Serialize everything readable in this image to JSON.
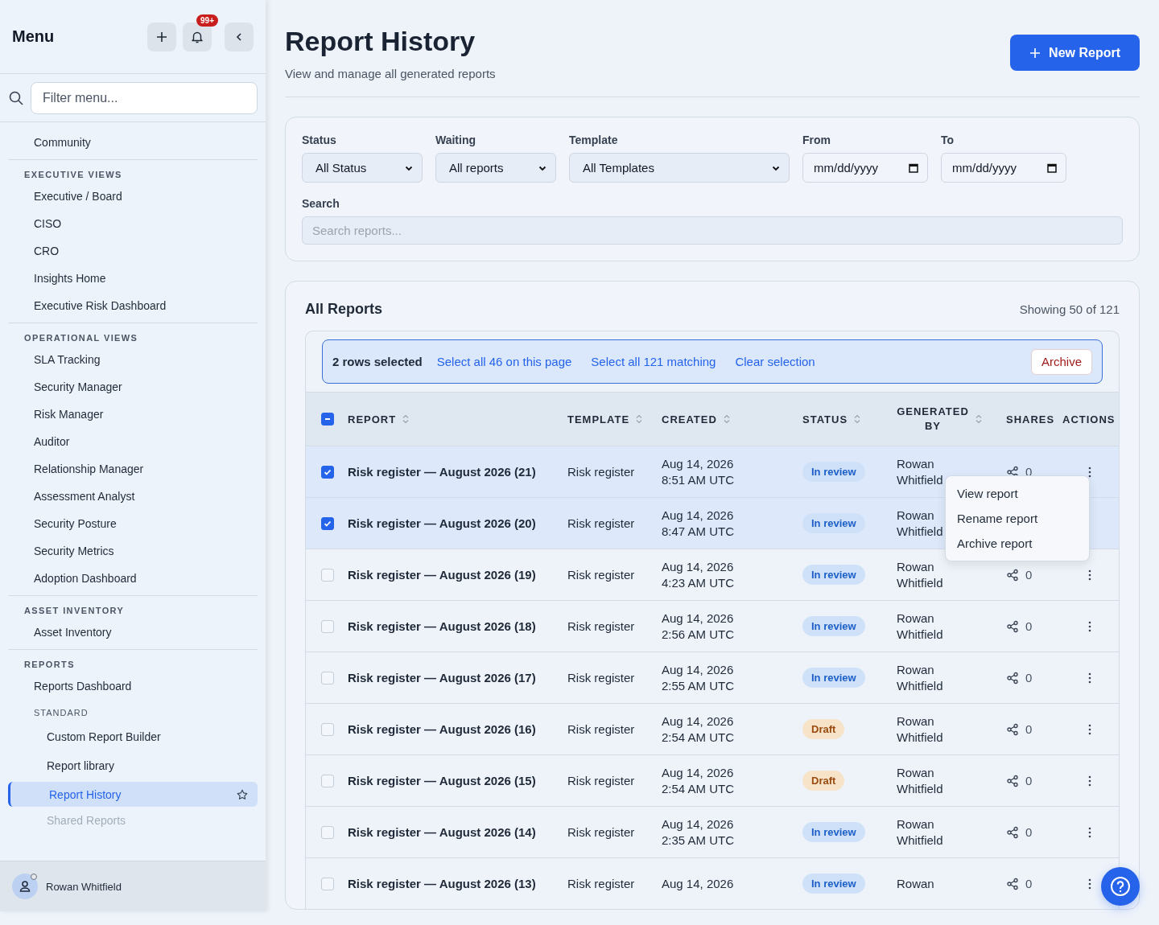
{
  "sidebar": {
    "title": "Menu",
    "notification_count": "99+",
    "filter_placeholder": "Filter menu...",
    "sections": [
      {
        "items": [
          {
            "kind": "link",
            "label": "Community",
            "selected": false
          }
        ]
      },
      {
        "label": "EXECUTIVE VIEWS",
        "items": [
          {
            "kind": "link",
            "label": "Executive / Board",
            "selected": false
          },
          {
            "kind": "link",
            "label": "CISO",
            "selected": false
          },
          {
            "kind": "link",
            "label": "CRO",
            "selected": false
          },
          {
            "kind": "link",
            "label": "Insights Home",
            "selected": false
          },
          {
            "kind": "link",
            "label": "Executive Risk Dashboard",
            "selected": false
          }
        ]
      },
      {
        "label": "OPERATIONAL VIEWS",
        "items": [
          {
            "kind": "link",
            "label": "SLA Tracking",
            "selected": false
          },
          {
            "kind": "link",
            "label": "Security Manager",
            "selected": false
          },
          {
            "kind": "link",
            "label": "Risk Manager",
            "selected": false
          },
          {
            "kind": "link",
            "label": "Auditor",
            "selected": false
          },
          {
            "kind": "link",
            "label": "Relationship Manager",
            "selected": false
          },
          {
            "kind": "link",
            "label": "Assessment Analyst",
            "selected": false
          },
          {
            "kind": "link",
            "label": "Security Posture",
            "selected": false
          },
          {
            "kind": "link",
            "label": "Security Metrics",
            "selected": false
          },
          {
            "kind": "link",
            "label": "Adoption Dashboard",
            "selected": false
          }
        ]
      },
      {
        "label": "ASSET INVENTORY",
        "items": [
          {
            "kind": "link",
            "label": "Asset Inventory",
            "selected": false
          }
        ]
      },
      {
        "label": "REPORTS",
        "items": [
          {
            "kind": "link",
            "label": "Reports Dashboard",
            "selected": false
          },
          {
            "kind": "group",
            "label": "STANDARD",
            "children": [
              {
                "kind": "link",
                "label": "Custom Report Builder",
                "selected": false
              },
              {
                "kind": "link",
                "label": "Report library",
                "selected": false
              },
              {
                "kind": "link",
                "label": "Report History",
                "selected": true
              },
              {
                "kind": "link",
                "label": "Shared Reports",
                "selected": false
              }
            ]
          }
        ]
      }
    ],
    "user": {
      "name": "Rowan Whitfield"
    }
  },
  "header": {
    "title": "Report History",
    "subtitle": "View and manage all generated reports",
    "new_button": "New Report"
  },
  "filters": {
    "fields": [
      {
        "kind": "select",
        "label": "Status",
        "value": "All Status"
      },
      {
        "kind": "select",
        "label": "Waiting",
        "value": "All reports"
      },
      {
        "kind": "select",
        "label": "Template",
        "value": "All Templates"
      },
      {
        "kind": "date",
        "label": "From",
        "placeholder": "mm/dd/yyyy"
      },
      {
        "kind": "date",
        "label": "To",
        "placeholder": "mm/dd/yyyy"
      }
    ],
    "search": {
      "label": "Search",
      "placeholder": "Search reports..."
    }
  },
  "reports": {
    "title": "All Reports",
    "count": "Showing 50 of 121",
    "selection_bar": {
      "text": "2 rows selected",
      "links": [
        "Select all 46 on this page",
        "Select all 121 matching",
        "Clear selection"
      ],
      "archive_button": "Archive"
    },
    "header_checkbox": {
      "indeterminate": true
    },
    "columns": [
      {
        "label": "REPORT",
        "sortable": true
      },
      {
        "label": "TEMPLATE",
        "sortable": true
      },
      {
        "label": "CREATED",
        "sortable": true
      },
      {
        "label": "STATUS",
        "sortable": true
      },
      {
        "label": "GENERATED BY",
        "sortable": true
      },
      {
        "label": "SHARES",
        "sortable": false
      },
      {
        "label": "ACTIONS",
        "sortable": false
      }
    ],
    "rows": [
      {
        "checked": true,
        "title": "Risk register — August 2026 (21)",
        "template": "Risk register",
        "date": "Aug 14, 2026",
        "time": "8:51 AM UTC",
        "status": {
          "kind": "review",
          "label": "In review"
        },
        "generated_by": "Rowan Whitfield",
        "shares": "0",
        "menu": [
          "View report",
          "Rename report",
          "Archive report"
        ]
      },
      {
        "checked": true,
        "title": "Risk register — August 2026 (20)",
        "template": "Risk register",
        "date": "Aug 14, 2026",
        "time": "8:47 AM UTC",
        "status": {
          "kind": "review",
          "label": "In review"
        },
        "generated_by": "Rowan Whitfield"
      },
      {
        "checked": false,
        "title": "Risk register — August 2026 (19)",
        "template": "Risk register",
        "date": "Aug 14, 2026",
        "time": "4:23 AM UTC",
        "status": {
          "kind": "review",
          "label": "In review"
        },
        "generated_by": "Rowan Whitfield",
        "shares": "0"
      },
      {
        "checked": false,
        "title": "Risk register — August 2026 (18)",
        "template": "Risk register",
        "date": "Aug 14, 2026",
        "time": "2:56 AM UTC",
        "status": {
          "kind": "review",
          "label": "In review"
        },
        "generated_by": "Rowan Whitfield",
        "shares": "0"
      },
      {
        "checked": false,
        "title": "Risk register — August 2026 (17)",
        "template": "Risk register",
        "date": "Aug 14, 2026",
        "time": "2:55 AM UTC",
        "status": {
          "kind": "review",
          "label": "In review"
        },
        "generated_by": "Rowan Whitfield",
        "shares": "0"
      },
      {
        "checked": false,
        "title": "Risk register — August 2026 (16)",
        "template": "Risk register",
        "date": "Aug 14, 2026",
        "time": "2:54 AM UTC",
        "status": {
          "kind": "draft",
          "label": "Draft"
        },
        "generated_by": "Rowan Whitfield",
        "shares": "0"
      },
      {
        "checked": false,
        "title": "Risk register — August 2026 (15)",
        "template": "Risk register",
        "date": "Aug 14, 2026",
        "time": "2:54 AM UTC",
        "status": {
          "kind": "draft",
          "label": "Draft"
        },
        "generated_by": "Rowan Whitfield",
        "shares": "0"
      },
      {
        "checked": false,
        "title": "Risk register — August 2026 (14)",
        "template": "Risk register",
        "date": "Aug 14, 2026",
        "time": "2:35 AM UTC",
        "status": {
          "kind": "review",
          "label": "In review"
        },
        "generated_by": "Rowan Whitfield",
        "shares": "0"
      },
      {
        "checked": false,
        "title": "Risk register — August 2026 (13)",
        "template": "Risk register",
        "date": "Aug 14, 2026",
        "status": {
          "kind": "review",
          "label": "In review"
        },
        "generated_by": "Rowan",
        "shares": "0"
      }
    ]
  }
}
